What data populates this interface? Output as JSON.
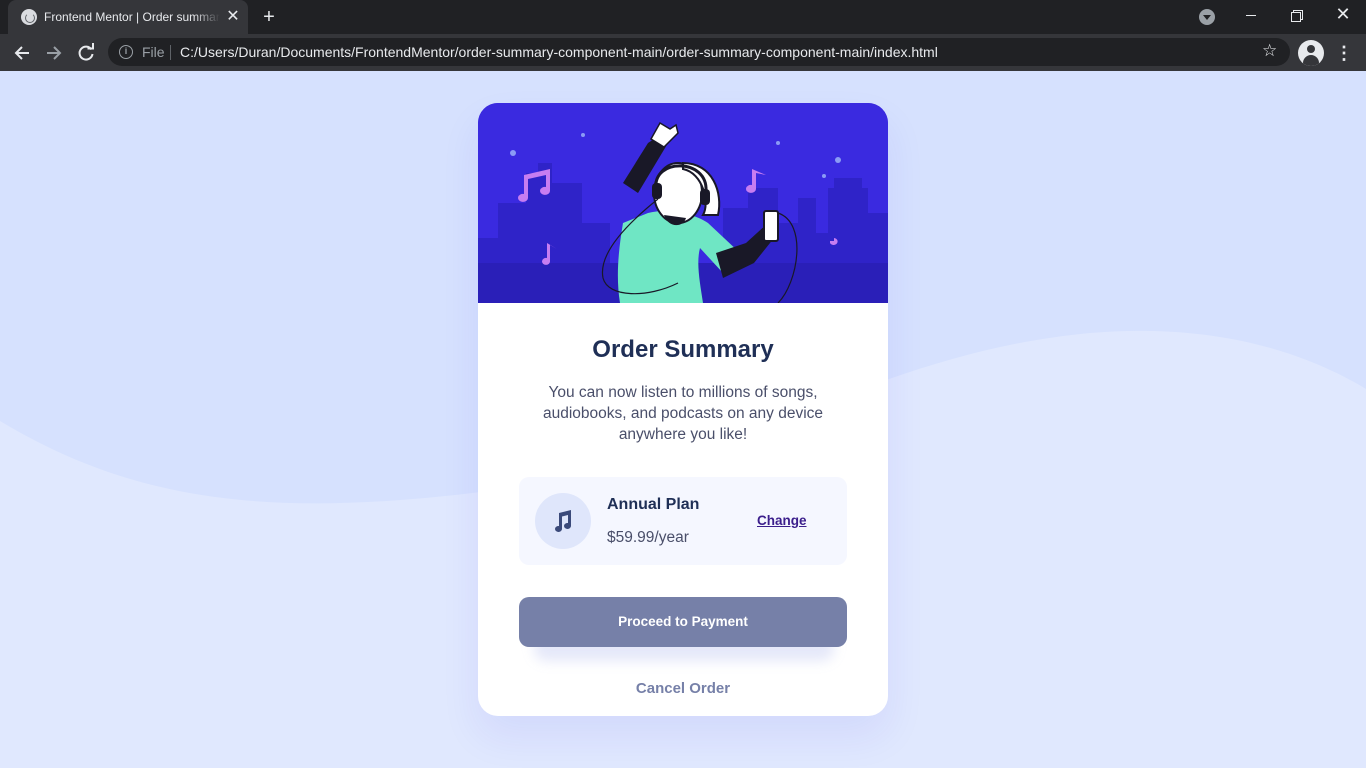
{
  "browser": {
    "tab_title": "Frontend Mentor | Order summary",
    "tab_close_glyph": "✕",
    "new_tab_glyph": "+",
    "file_label": "File",
    "url": "C:/Users/Duran/Documents/FrontendMentor/order-summary-component-main/order-summary-component-main/index.html",
    "icons": [
      "favicon-icon",
      "close-icon",
      "plus-icon",
      "tab-search-icon",
      "minimize-icon",
      "maximize-icon",
      "window-close-icon",
      "back-icon",
      "forward-icon",
      "reload-icon",
      "info-icon",
      "star-icon",
      "profile-icon",
      "menu-icon"
    ]
  },
  "card": {
    "title": "Order Summary",
    "description": "You can now listen to millions of songs, audiobooks, and podcasts on any device anywhere you like!",
    "plan": {
      "name": "Annual Plan",
      "price": "$59.99/year",
      "change_label": "Change",
      "icon": "music-note-icon"
    },
    "pay_label": "Proceed to Payment",
    "cancel_label": "Cancel Order"
  },
  "colors": {
    "page_background": "#e0e8fe",
    "hero_background": "#3a2ae0",
    "title": "#1f2f56",
    "button": "#7680a8",
    "link": "#3b1e8c"
  }
}
